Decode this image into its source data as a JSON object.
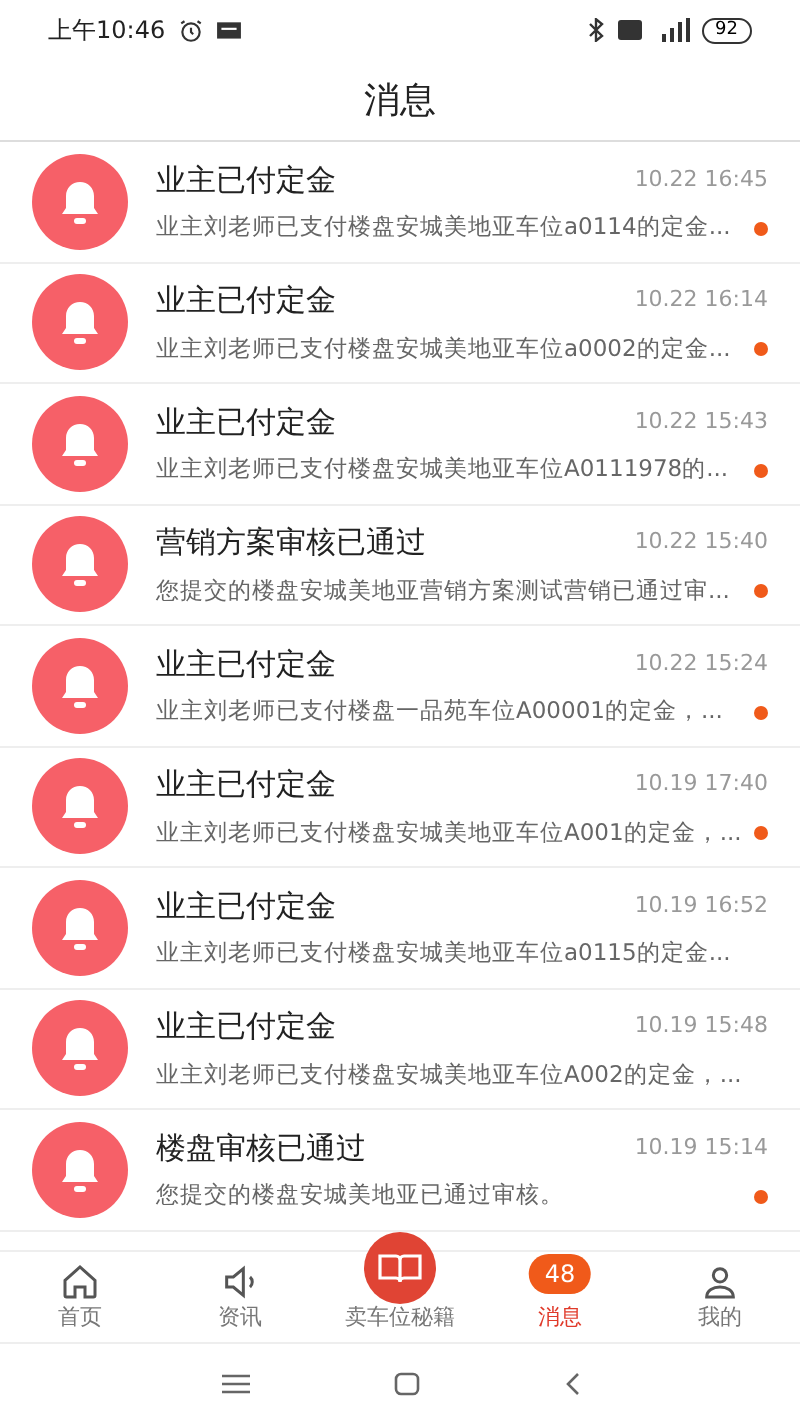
{
  "status_bar": {
    "time": "上午10:46",
    "battery": "92"
  },
  "header": {
    "title": "消息"
  },
  "messages": [
    {
      "title": "业主已付定金",
      "time": "10.22 16:45",
      "preview": "业主刘老师已支付楼盘安城美地亚车位a0114的定金...",
      "unread": true
    },
    {
      "title": "业主已付定金",
      "time": "10.22 16:14",
      "preview": "业主刘老师已支付楼盘安城美地亚车位a0002的定金...",
      "unread": true
    },
    {
      "title": "业主已付定金",
      "time": "10.22 15:43",
      "preview": "业主刘老师已支付楼盘安城美地亚车位A0111978的...",
      "unread": true
    },
    {
      "title": "营销方案审核已通过",
      "time": "10.22 15:40",
      "preview": "您提交的楼盘安城美地亚营销方案测试营销已通过审...",
      "unread": true
    },
    {
      "title": "业主已付定金",
      "time": "10.22 15:24",
      "preview": "业主刘老师已支付楼盘一品苑车位A00001的定金，...",
      "unread": true
    },
    {
      "title": "业主已付定金",
      "time": "10.19 17:40",
      "preview": "业主刘老师已支付楼盘安城美地亚车位A001的定金，...",
      "unread": true
    },
    {
      "title": "业主已付定金",
      "time": "10.19 16:52",
      "preview": "业主刘老师已支付楼盘安城美地亚车位a0115的定金...",
      "unread": false
    },
    {
      "title": "业主已付定金",
      "time": "10.19 15:48",
      "preview": "业主刘老师已支付楼盘安城美地亚车位A002的定金，...",
      "unread": false
    },
    {
      "title": "楼盘审核已通过",
      "time": "10.19 15:14",
      "preview": "您提交的楼盘安城美地亚已通过审核。",
      "unread": true
    }
  ],
  "tabs": [
    {
      "label": "首页",
      "kind": "home",
      "selected": false
    },
    {
      "label": "资讯",
      "kind": "news",
      "selected": false
    },
    {
      "label": "卖车位秘籍",
      "kind": "book",
      "selected": false
    },
    {
      "label": "消息",
      "kind": "message",
      "selected": true,
      "badge": "48"
    },
    {
      "label": "我的",
      "kind": "profile",
      "selected": false
    }
  ]
}
